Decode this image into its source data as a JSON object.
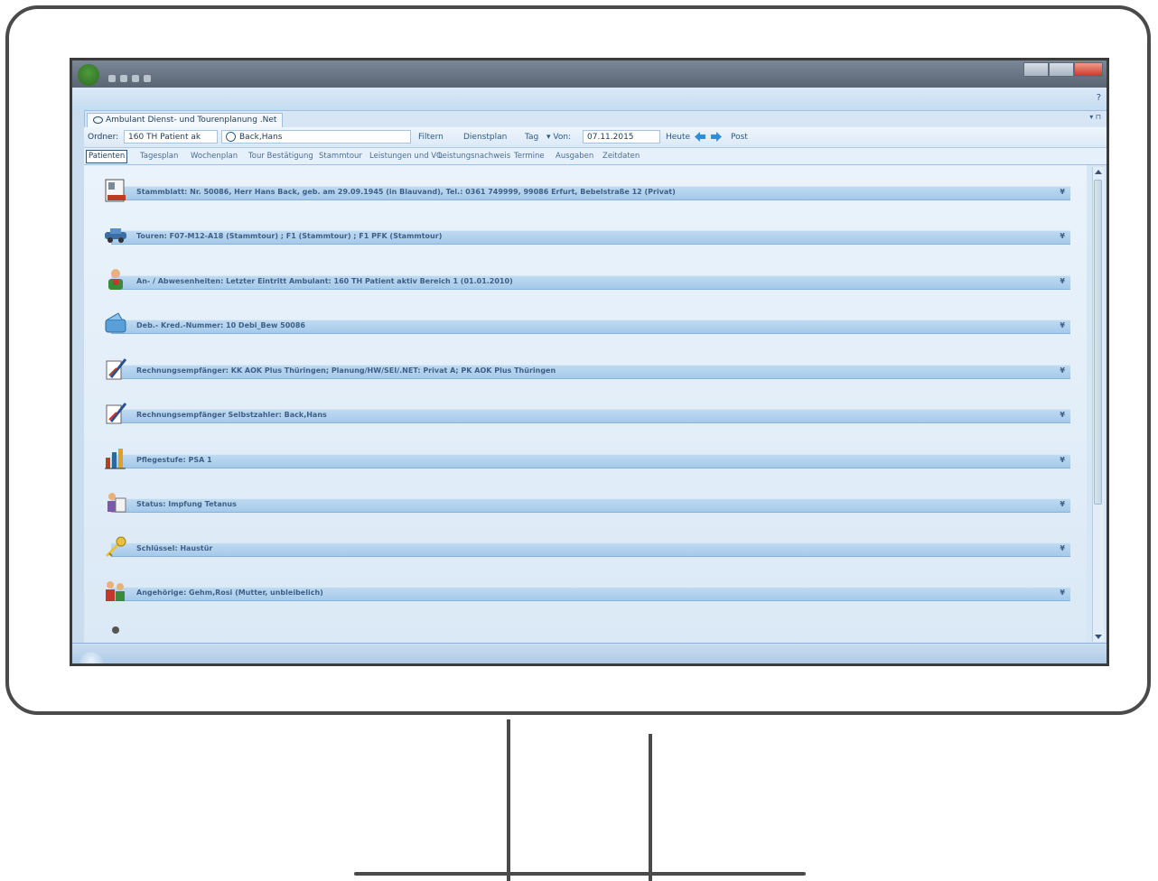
{
  "app": {
    "title_bar_text": "Ambulant Dienst- und Tourenplanung .Net",
    "help": "?",
    "tab_pin": "▾ ⊓"
  },
  "toolbar": {
    "ordner_label": "Ordner:",
    "ordner_value": "160 TH Patient ak",
    "patient_value": "Back,Hans",
    "filter": "Filtern",
    "dienstplan": "Dienstplan",
    "tag": "Tag",
    "von": "▾ Von:",
    "date": "07.11.2015",
    "heute": "Heute",
    "post": "Post"
  },
  "nav_tabs": [
    {
      "label": "Patienten",
      "active": true
    },
    {
      "label": "Tagesplan"
    },
    {
      "label": "Wochenplan"
    },
    {
      "label": "Tour Bestätigung"
    },
    {
      "label": "Stammtour"
    },
    {
      "label": "Leistungen und VO"
    },
    {
      "label": "Leistungsnachweis"
    },
    {
      "label": "Termine"
    },
    {
      "label": "Ausgaben"
    },
    {
      "label": "Zeitdaten"
    }
  ],
  "sections": [
    {
      "icon": "id-card-icon",
      "label": "Stammblatt: Nr. 50086, Herr Hans Back,  geb. am 29.09.1945 (in Blauvand), Tel.: 0361 749999, 99086 Erfurt, Bebelstraße 12 (Privat)"
    },
    {
      "icon": "car-icon",
      "label": "Touren: F07-M12-A18 (Stammtour) ; F1 (Stammtour) ; F1 PFK  (Stammtour)"
    },
    {
      "icon": "person-icon",
      "label": "An- / Abwesenheiten: Letzter Eintritt Ambulant: 160 TH Patient aktiv Bereich 1  (01.01.2010)"
    },
    {
      "icon": "wallet-icon",
      "label": "Deb.- Kred.-Nummer: 10 Debi_Bew 50086"
    },
    {
      "icon": "pen-icon",
      "label": "Rechnungsempfänger: KK AOK Plus Thüringen;  Planung/HW/SEI/.NET:  Privat A; PK AOK Plus Thüringen"
    },
    {
      "icon": "pen-icon",
      "label": "Rechnungsempfänger Selbstzahler: Back,Hans"
    },
    {
      "icon": "bar-chart-icon",
      "label": "Pflegestufe: PSA 1"
    },
    {
      "icon": "clipboard-icon",
      "label": "Status: Impfung Tetanus"
    },
    {
      "icon": "key-icon",
      "label": "Schlüssel: Haustür"
    },
    {
      "icon": "family-icon",
      "label": "Angehörige: Gehm,Rosi (Mutter, unbleibelich)"
    }
  ],
  "colors": {
    "frame": "#4a4a4a",
    "accent": "#3f5f86",
    "bar": "#a5c9ea"
  }
}
